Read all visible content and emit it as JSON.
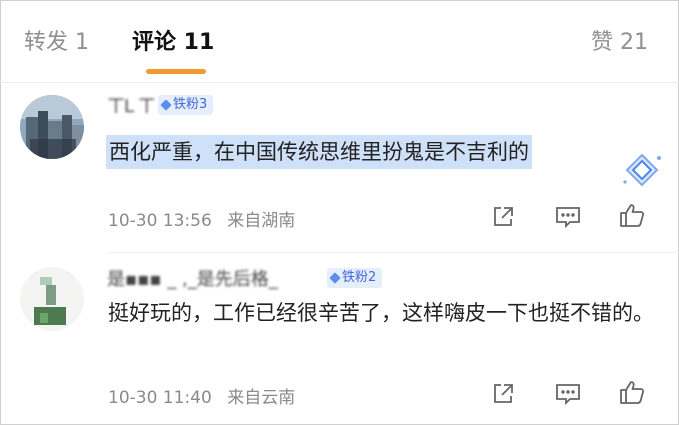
{
  "tabs": {
    "repost": "转发 1",
    "comments": "评论 11",
    "likes": "赞 21"
  },
  "colors": {
    "accent_underline": "#f29a2e",
    "badge_bg": "#e6edfb",
    "badge_text": "#3f6ad8",
    "selection_highlight": "#cfe0f9"
  },
  "comments": [
    {
      "username": "ㄒL ㄒ",
      "badge": "铁粉3",
      "text": "西化严重，在中国传统思维里扮鬼是不吉利的",
      "time": "10-30 13:56",
      "location": "来自湖南",
      "icons": [
        "share-icon",
        "reply-icon",
        "like-icon"
      ]
    },
    {
      "username": "是▪▪▪ _ ,_是先后格_",
      "badge": "铁粉2",
      "text": "挺好玩的，工作已经很辛苦了，这样嗨皮一下也挺不错的。",
      "time": "10-30 11:40",
      "location": "来自云南",
      "icons": [
        "share-icon",
        "reply-icon",
        "like-icon"
      ]
    }
  ]
}
